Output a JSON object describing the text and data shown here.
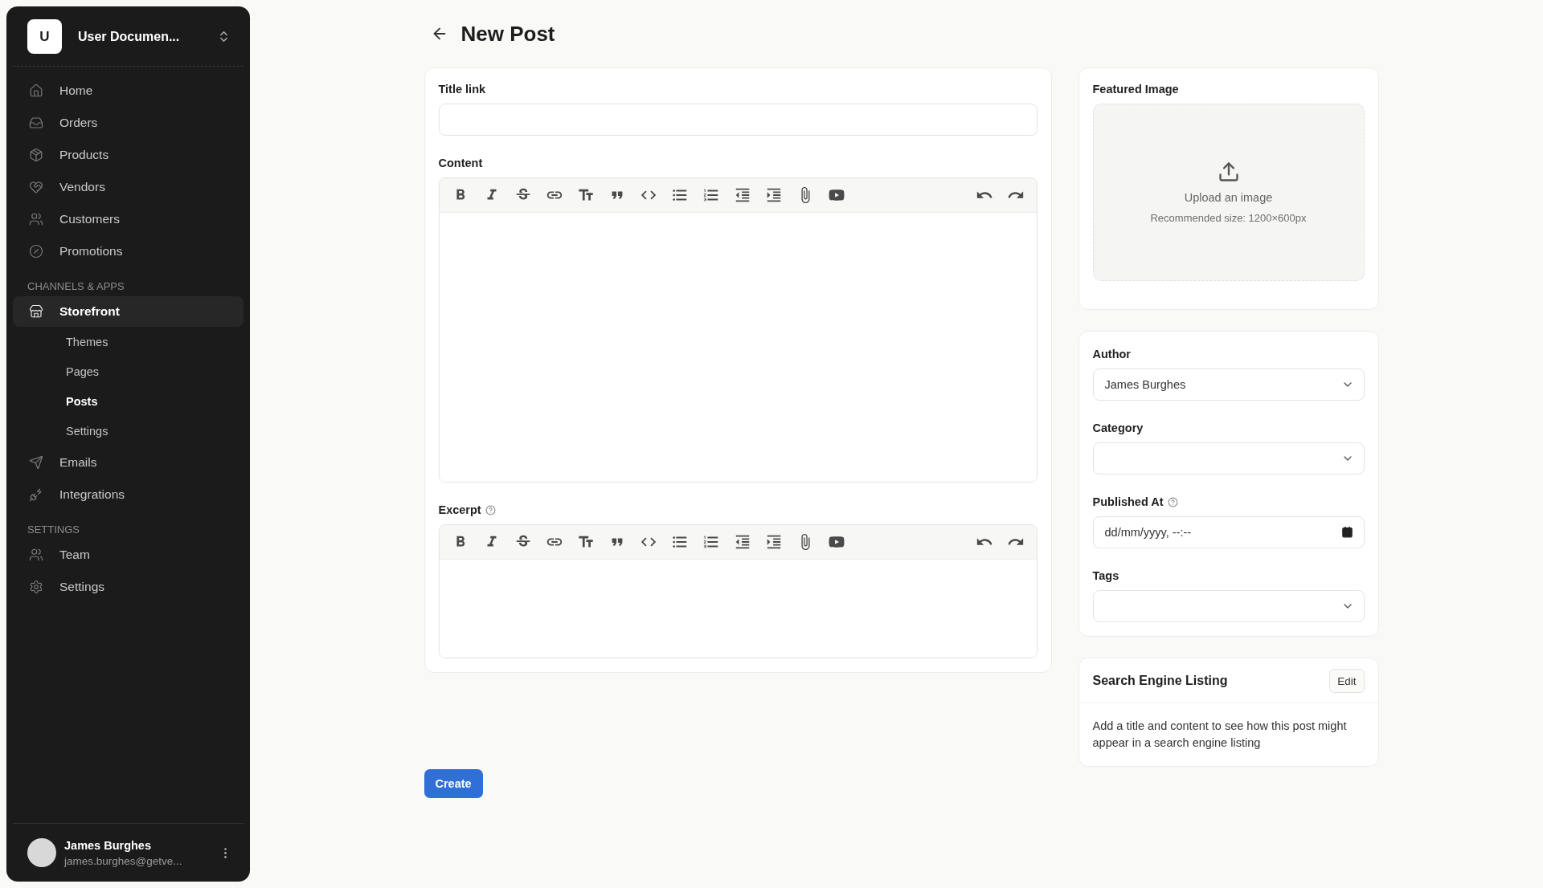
{
  "sidebar": {
    "workspace": {
      "initial": "U",
      "name": "User Documen..."
    },
    "sections": [
      {
        "items": [
          {
            "label": "Home",
            "selected": false
          },
          {
            "label": "Orders",
            "selected": false
          },
          {
            "label": "Products",
            "selected": false
          },
          {
            "label": "Vendors",
            "selected": false
          },
          {
            "label": "Customers",
            "selected": false
          },
          {
            "label": "Promotions",
            "selected": false
          }
        ]
      },
      {
        "heading": "CHANNELS & APPS",
        "items": [
          {
            "label": "Storefront",
            "selected": true,
            "children": [
              {
                "label": "Themes",
                "selected": false
              },
              {
                "label": "Pages",
                "selected": false
              },
              {
                "label": "Posts",
                "selected": true
              },
              {
                "label": "Settings",
                "selected": false
              }
            ]
          },
          {
            "label": "Emails",
            "selected": false
          },
          {
            "label": "Integrations",
            "selected": false
          }
        ]
      },
      {
        "heading": "SETTINGS",
        "items": [
          {
            "label": "Team",
            "selected": false
          },
          {
            "label": "Settings",
            "selected": false
          }
        ]
      }
    ],
    "user": {
      "name": "James Burghes",
      "email": "james.burghes@getve..."
    }
  },
  "page": {
    "title": "New Post"
  },
  "form": {
    "title_label": "Title link",
    "content_label": "Content",
    "excerpt_label": "Excerpt",
    "submit": "Create"
  },
  "featured_image": {
    "title": "Featured Image",
    "action": "Upload an image",
    "hint": "Recommended size: 1200×600px"
  },
  "details": {
    "fields": [
      {
        "label": "Author",
        "kind": "select",
        "value": "James Burghes",
        "help": false
      },
      {
        "label": "Category",
        "kind": "select",
        "help": false
      },
      {
        "label": "Published At",
        "kind": "datetime",
        "placeholder": "dd/mm/yyyy, --:--",
        "help": true
      },
      {
        "label": "Tags",
        "kind": "select",
        "help": false
      }
    ]
  },
  "seo": {
    "title": "Search Engine Listing",
    "button": "Edit",
    "text": "Add a title and content to see how this post might appear in a search engine listing"
  }
}
